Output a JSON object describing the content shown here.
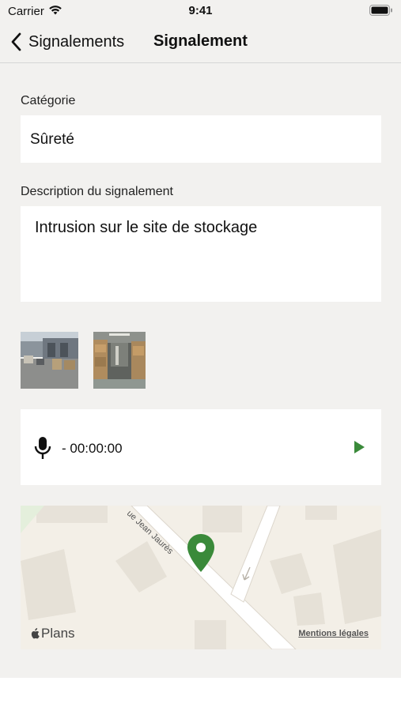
{
  "status_bar": {
    "carrier": "Carrier",
    "time": "9:41"
  },
  "nav": {
    "back_label": "Signalements",
    "title": "Signalement"
  },
  "category": {
    "label": "Catégorie",
    "value": "Sûreté"
  },
  "description": {
    "label": "Description du signalement",
    "value": "Intrusion sur le site de stockage"
  },
  "photos": [
    {
      "name": "photo-thumbnail-1"
    },
    {
      "name": "photo-thumbnail-2"
    }
  ],
  "audio": {
    "duration": "- 00:00:00",
    "mic_icon": "microphone-icon",
    "play_icon": "play-icon"
  },
  "map": {
    "street_label": "ue Jean Jaurès",
    "brand": "Plans",
    "legal_link": "Mentions légales",
    "pin_color": "#3a8a3a"
  },
  "colors": {
    "background": "#f2f1ef",
    "accent": "#3a8a3a",
    "card": "#ffffff"
  }
}
